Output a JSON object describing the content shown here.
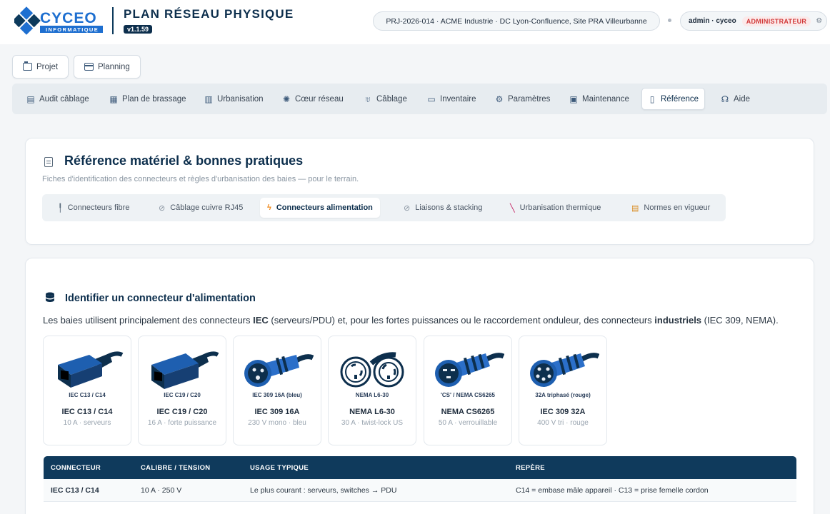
{
  "header": {
    "brand_name": "CYCEO",
    "brand_tagline": "INFORMATIQUE",
    "app_title": "PLAN RÉSEAU PHYSIQUE",
    "version": "v1.1.59",
    "project": "PRJ-2026-014 · ACME Industrie · DC Lyon-Confluence, Site PRA Villeurbanne",
    "user": "admin · cyceo",
    "role": "ADMINISTRATEUR"
  },
  "top_buttons": {
    "projet": "Projet",
    "planning": "Planning"
  },
  "nav": [
    {
      "label": "Audit câblage",
      "icon": "audit-icon"
    },
    {
      "label": "Plan de brassage",
      "icon": "patch-plan-icon"
    },
    {
      "label": "Urbanisation",
      "icon": "building-icon"
    },
    {
      "label": "Cœur réseau",
      "icon": "core-icon"
    },
    {
      "label": "Câblage",
      "icon": "cable-icon"
    },
    {
      "label": "Inventaire",
      "icon": "inventory-icon"
    },
    {
      "label": "Paramètres",
      "icon": "gear-icon"
    },
    {
      "label": "Maintenance",
      "icon": "save-icon"
    },
    {
      "label": "Référence",
      "icon": "document-icon"
    },
    {
      "label": "Aide",
      "icon": "help-icon"
    }
  ],
  "reference": {
    "title": "Référence matériel & bonnes pratiques",
    "subtitle": "Fiches d'identification des connecteurs et règles d'urbanisation des baies — pour le terrain.",
    "tabs": [
      {
        "label": "Connecteurs fibre",
        "icon": "pin-icon"
      },
      {
        "label": "Câblage cuivre RJ45",
        "icon": "link-icon"
      },
      {
        "label": "Connecteurs alimentation",
        "icon": "bolt-icon"
      },
      {
        "label": "Liaisons & stacking",
        "icon": "link-icon"
      },
      {
        "label": "Urbanisation thermique",
        "icon": "thermometer-icon"
      },
      {
        "label": "Normes en vigueur",
        "icon": "scroll-icon"
      }
    ]
  },
  "section": {
    "title": "Identifier un connecteur d'alimentation",
    "intro_1": "Les baies utilisent principalement des connecteurs ",
    "intro_b1": "IEC",
    "intro_2": " (serveurs/PDU) et, pour les fortes puissances ou le raccordement onduleur, des connecteurs ",
    "intro_b2": "industriels",
    "intro_3": " (IEC 309, NEMA).",
    "connectors": [
      {
        "caption": "IEC C13 / C14",
        "name": "IEC C13 / C14",
        "desc": "10 A · serveurs",
        "color": "#2b6fc9"
      },
      {
        "caption": "IEC C19 / C20",
        "name": "IEC C19 / C20",
        "desc": "16 A · forte puissance",
        "color": "#2b6fc9"
      },
      {
        "caption": "IEC 309 16A (bleu)",
        "name": "IEC 309 16A",
        "desc": "230 V mono · bleu",
        "color": "#2b6fc9"
      },
      {
        "caption": "NEMA L6-30",
        "name": "NEMA L6-30",
        "desc": "30 A · twist-lock US",
        "color": "#2b6fc9"
      },
      {
        "caption": "'CS' / NEMA CS6265",
        "name": "NEMA CS6265",
        "desc": "50 A · verrouillable",
        "color": "#2b6fc9"
      },
      {
        "caption": "32A triphasé (rouge)",
        "name": "IEC 309 32A",
        "desc": "400 V tri · rouge",
        "color": "#2b6fc9"
      }
    ],
    "table": {
      "headers": [
        "CONNECTEUR",
        "CALIBRE / TENSION",
        "USAGE TYPIQUE",
        "REPÈRE"
      ],
      "rows": [
        [
          "IEC C13 / C14",
          "10 A · 250 V",
          "Le plus courant : serveurs, switches → PDU",
          "C14 = embase mâle appareil · C13 = prise femelle cordon"
        ]
      ]
    }
  }
}
